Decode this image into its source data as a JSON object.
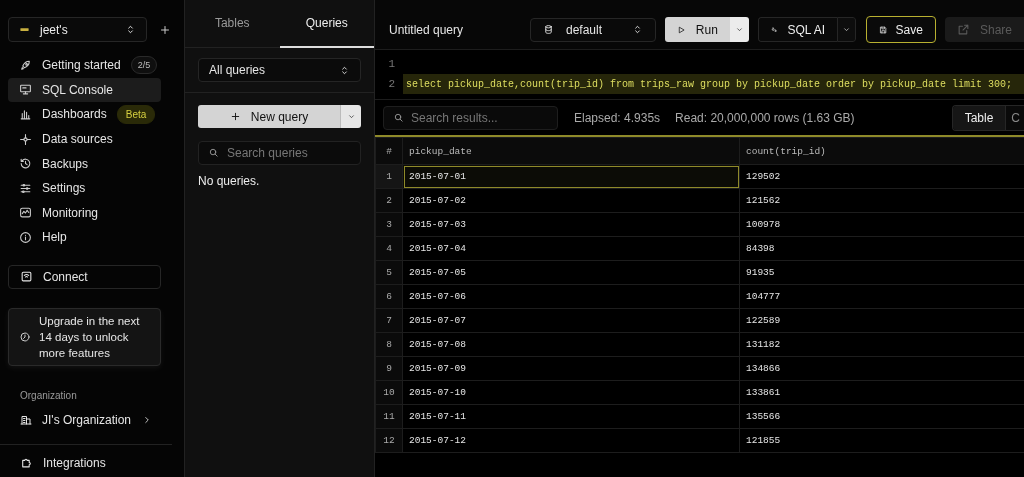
{
  "sidebar": {
    "workspace": "jeet's",
    "nav": [
      {
        "label": "Getting started",
        "selected": false,
        "badge": {
          "text": "2/5",
          "kind": "neutral"
        }
      },
      {
        "label": "SQL Console",
        "selected": true
      },
      {
        "label": "Dashboards",
        "selected": false,
        "badge": {
          "text": "Beta",
          "kind": "highlight"
        }
      },
      {
        "label": "Data sources",
        "selected": false
      },
      {
        "label": "Backups",
        "selected": false
      },
      {
        "label": "Settings",
        "selected": false
      },
      {
        "label": "Monitoring",
        "selected": false
      },
      {
        "label": "Help",
        "selected": false
      }
    ],
    "connect": "Connect",
    "upgrade": "Upgrade in the next 14 days to unlock more features",
    "organization_label": "Organization",
    "organization": "JI's Organization",
    "integrations": "Integrations"
  },
  "query_panel": {
    "tabs": [
      {
        "label": "Tables",
        "selected": false
      },
      {
        "label": "Queries",
        "selected": true
      }
    ],
    "filter": "All queries",
    "new_query": "New query",
    "search": {
      "placeholder": "Search queries"
    },
    "empty": "No queries."
  },
  "toolbar": {
    "title": "Untitled query",
    "database": "default",
    "run": "Run",
    "sql_ai": "SQL AI",
    "save": "Save",
    "share": {
      "label": "Share",
      "disabled": true
    }
  },
  "editor": {
    "lines": [
      {
        "number": "1",
        "highlighted": false
      },
      {
        "number": "2",
        "code": "select pickup_date,count(trip_id) from trips_raw group by pickup_date order by pickup_date limit 300;",
        "highlighted": true
      }
    ]
  },
  "results": {
    "search": {
      "placeholder": "Search results..."
    },
    "elapsed": "Elapsed: 4.935s",
    "read": "Read: 20,000,000 rows (1.63 GB)",
    "views": [
      {
        "label": "Table",
        "selected": true
      },
      {
        "label": "C",
        "selected": false
      }
    ]
  },
  "table": {
    "number_header": "#",
    "columns": [
      "pickup_date",
      "count(trip_id)"
    ],
    "rows": [
      {
        "number": "1",
        "cells": [
          {
            "text": "2015-07-01",
            "selected": true
          },
          {
            "text": "129502",
            "selected": false
          }
        ]
      },
      {
        "number": "2",
        "cells": [
          {
            "text": "2015-07-02",
            "selected": false
          },
          {
            "text": "121562",
            "selected": false
          }
        ]
      },
      {
        "number": "3",
        "cells": [
          {
            "text": "2015-07-03",
            "selected": false
          },
          {
            "text": "100978",
            "selected": false
          }
        ]
      },
      {
        "number": "4",
        "cells": [
          {
            "text": "2015-07-04",
            "selected": false
          },
          {
            "text": "84398",
            "selected": false
          }
        ]
      },
      {
        "number": "5",
        "cells": [
          {
            "text": "2015-07-05",
            "selected": false
          },
          {
            "text": "91935",
            "selected": false
          }
        ]
      },
      {
        "number": "6",
        "cells": [
          {
            "text": "2015-07-06",
            "selected": false
          },
          {
            "text": "104777",
            "selected": false
          }
        ]
      },
      {
        "number": "7",
        "cells": [
          {
            "text": "2015-07-07",
            "selected": false
          },
          {
            "text": "122589",
            "selected": false
          }
        ]
      },
      {
        "number": "8",
        "cells": [
          {
            "text": "2015-07-08",
            "selected": false
          },
          {
            "text": "131182",
            "selected": false
          }
        ]
      },
      {
        "number": "9",
        "cells": [
          {
            "text": "2015-07-09",
            "selected": false
          },
          {
            "text": "134866",
            "selected": false
          }
        ]
      },
      {
        "number": "10",
        "cells": [
          {
            "text": "2015-07-10",
            "selected": false
          },
          {
            "text": "133861",
            "selected": false
          }
        ]
      },
      {
        "number": "11",
        "cells": [
          {
            "text": "2015-07-11",
            "selected": false
          },
          {
            "text": "135566",
            "selected": false
          }
        ]
      },
      {
        "number": "12",
        "cells": [
          {
            "text": "2015-07-12",
            "selected": false
          },
          {
            "text": "121855",
            "selected": false
          }
        ]
      }
    ]
  }
}
